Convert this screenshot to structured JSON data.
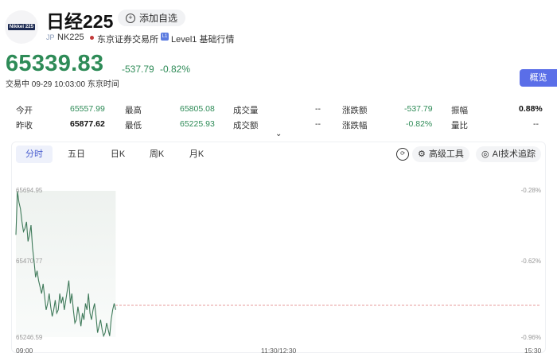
{
  "header": {
    "logo_text": "Nikkei 225",
    "title": "日经225",
    "add_label": "添加自选",
    "market_tag": "JP",
    "code": "NK225",
    "exchange": "东京证券交易所",
    "level_tag": "L1",
    "level": "Level1 基础行情"
  },
  "quote": {
    "price": "65339.83",
    "change": "-537.79",
    "change_pct": "-0.82%",
    "status": "交易中 09-29 10:03:00 东京时间",
    "overview_label": "概览"
  },
  "stats": [
    {
      "label": "今开",
      "value": "65557.99"
    },
    {
      "label": "最高",
      "value": "65805.08"
    },
    {
      "label": "成交量",
      "value": "--"
    },
    {
      "label": "涨跌额",
      "value": "-537.79"
    },
    {
      "label": "振幅",
      "value": "0.88%"
    },
    {
      "label": "昨收",
      "value": "65877.62"
    },
    {
      "label": "最低",
      "value": "65225.93"
    },
    {
      "label": "成交额",
      "value": "--"
    },
    {
      "label": "涨跌幅",
      "value": "-0.82%"
    },
    {
      "label": "量比",
      "value": "--"
    }
  ],
  "chart_tabs": [
    "分时",
    "五日",
    "日K",
    "周K",
    "月K"
  ],
  "tools": {
    "advanced": "高级工具",
    "ai": "AI技术追踪"
  },
  "chart_data": {
    "type": "line",
    "y_labels_left": [
      "65694.95",
      "65470.77",
      "65246.59"
    ],
    "y_labels_right": [
      "-0.28%",
      "-0.62%",
      "-0.96%"
    ],
    "x_labels": [
      "09:00",
      "11:30/12:30",
      "15:30"
    ],
    "ylim": [
      65246.59,
      65694.95
    ],
    "prev_close": 65877.62,
    "series": [
      {
        "values": [
          65560,
          65694,
          65660,
          65640,
          65600,
          65570,
          65580,
          65600,
          65540,
          65560,
          65590,
          65520,
          65480,
          65430,
          65450,
          65420,
          65400,
          65380,
          65410,
          65370,
          65330,
          65350,
          65380,
          65340,
          65310,
          65330,
          65360,
          65320,
          65330,
          65380,
          65350,
          65370,
          65330,
          65360,
          65390,
          65420,
          65350,
          65380,
          65330,
          65290,
          65300,
          65340,
          65310,
          65280,
          65320,
          65300,
          65350,
          65330,
          65380,
          65320,
          65300,
          65330,
          65350,
          65310,
          65260,
          65280,
          65300,
          65270,
          65250,
          65260,
          65290,
          65270,
          65250,
          65300,
          65330,
          65350,
          65330
        ]
      }
    ]
  }
}
